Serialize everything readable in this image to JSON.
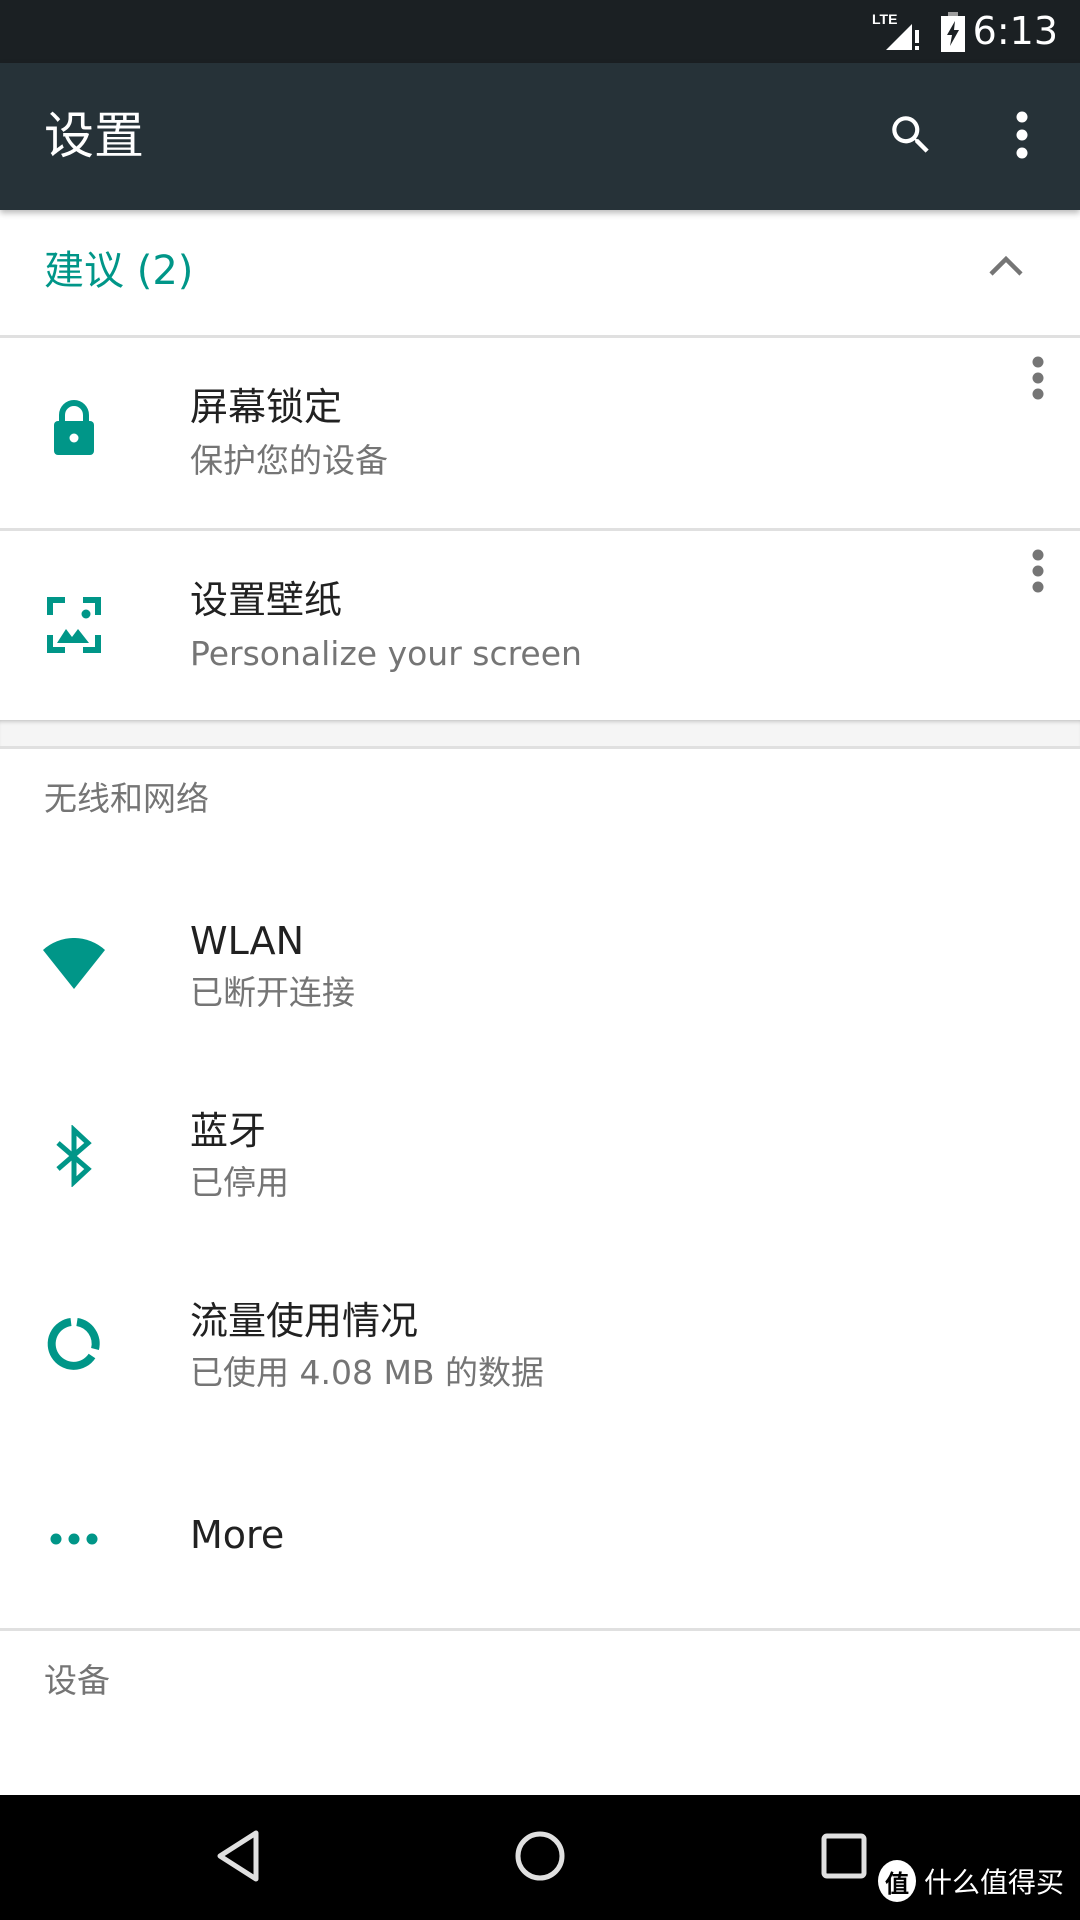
{
  "status_bar": {
    "network_label": "LTE",
    "time": "6:13",
    "icons": [
      "lte-signal-icon",
      "battery-charging-icon"
    ]
  },
  "toolbar": {
    "title": "设置",
    "actions": [
      "search-icon",
      "more-vert-icon"
    ]
  },
  "suggestions": {
    "header": "建议 (2)",
    "expanded": true,
    "items": [
      {
        "icon": "lock-icon",
        "title": "屏幕锁定",
        "subtitle": "保护您的设备"
      },
      {
        "icon": "wallpaper-icon",
        "title": "设置壁纸",
        "subtitle": "Personalize your screen"
      }
    ]
  },
  "categories": [
    {
      "title": "无线和网络",
      "items": [
        {
          "icon": "wifi-icon",
          "title": "WLAN",
          "subtitle": "已断开连接"
        },
        {
          "icon": "bluetooth-icon",
          "title": "蓝牙",
          "subtitle": "已停用"
        },
        {
          "icon": "data-usage-icon",
          "title": "流量使用情况",
          "subtitle": "已使用 4.08 MB 的数据"
        },
        {
          "icon": "more-horiz-icon",
          "title": "More"
        }
      ]
    },
    {
      "title": "设备"
    }
  ],
  "nav_bar": {
    "buttons": [
      "back-icon",
      "home-icon",
      "recents-icon"
    ]
  },
  "watermark": {
    "logo": "值",
    "text": "什么值得买"
  },
  "colors": {
    "accent": "#009688",
    "toolbar": "#263238",
    "status_bar": "#1b2023"
  }
}
